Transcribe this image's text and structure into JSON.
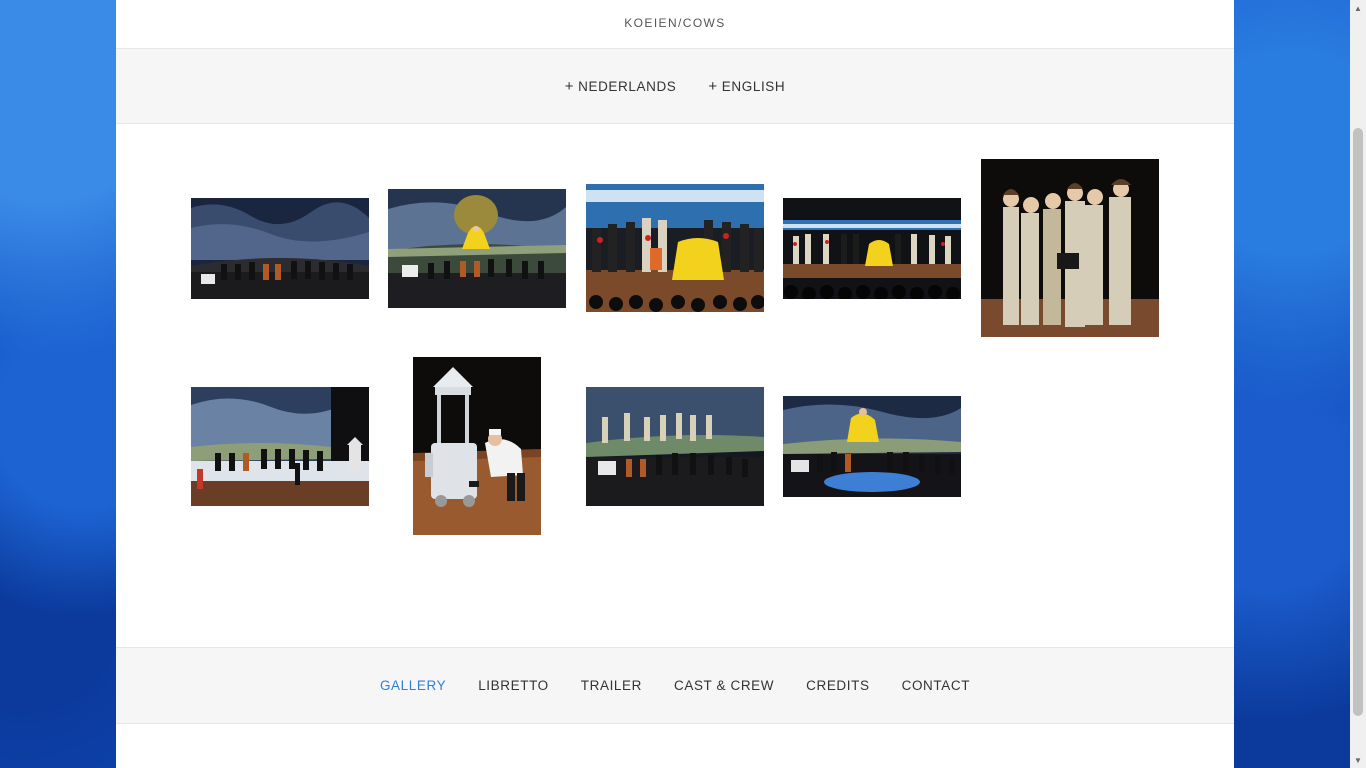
{
  "site": {
    "title": "KOEIEN/COWS"
  },
  "languages": [
    {
      "label": "NEDERLANDS"
    },
    {
      "label": "ENGLISH"
    }
  ],
  "gallery": {
    "images": [
      {
        "id": "photo-1",
        "alt": "photo-1"
      },
      {
        "id": "photo-2",
        "alt": "photo-2"
      },
      {
        "id": "photo-3",
        "alt": "photo-3"
      },
      {
        "id": "photo-4",
        "alt": "photo-4"
      },
      {
        "id": "photo-5",
        "alt": "photo-5"
      },
      {
        "id": "photo-6",
        "alt": "photo-6"
      },
      {
        "id": "photo-7",
        "alt": "photo-7"
      },
      {
        "id": "photo-8",
        "alt": "photo-8"
      },
      {
        "id": "photo-9",
        "alt": "photo-9"
      }
    ]
  },
  "nav": {
    "items": [
      {
        "label": "GALLERY",
        "active": true
      },
      {
        "label": "LIBRETTO",
        "active": false
      },
      {
        "label": "TRAILER",
        "active": false
      },
      {
        "label": "CAST & CREW",
        "active": false
      },
      {
        "label": "CREDITS",
        "active": false
      },
      {
        "label": "CONTACT",
        "active": false
      }
    ]
  },
  "colors": {
    "accent": "#2f7fd6",
    "text": "#333333",
    "bar_bg": "#f6f6f6"
  }
}
